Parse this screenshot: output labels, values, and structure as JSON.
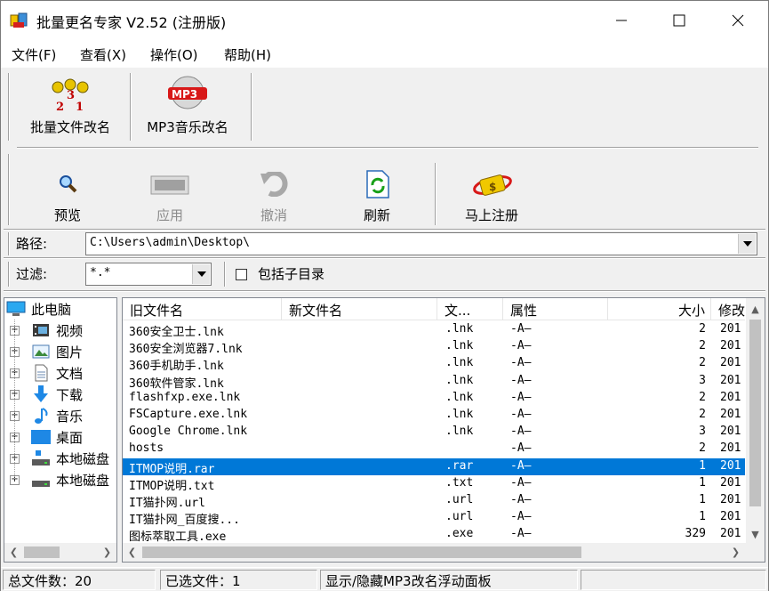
{
  "window": {
    "title": "批量更名专家 V2.52 (注册版)",
    "controls": {
      "minimize": "—",
      "maximize": "☐",
      "close": "✕"
    }
  },
  "menu": [
    "文件(F)",
    "查看(X)",
    "操作(O)",
    "帮助(H)"
  ],
  "toolbar_top": {
    "batch_rename": "批量文件改名",
    "mp3_rename": "MP3音乐改名"
  },
  "toolbar_actions": {
    "preview": "预览",
    "apply": "应用",
    "undo": "撤消",
    "refresh": "刷新",
    "register": "马上注册"
  },
  "path": {
    "label": "路径:",
    "value": "C:\\Users\\admin\\Desktop\\"
  },
  "filter": {
    "label": "过滤:",
    "value": "*.*",
    "include_subdirs": "包括子目录",
    "include_subdirs_checked": false
  },
  "tree": {
    "items": [
      {
        "label": "此电脑",
        "icon": "computer-icon"
      },
      {
        "label": "视频",
        "icon": "video-folder-icon"
      },
      {
        "label": "图片",
        "icon": "pictures-folder-icon"
      },
      {
        "label": "文档",
        "icon": "documents-folder-icon"
      },
      {
        "label": "下载",
        "icon": "downloads-folder-icon"
      },
      {
        "label": "音乐",
        "icon": "music-folder-icon"
      },
      {
        "label": "桌面",
        "icon": "desktop-folder-icon"
      },
      {
        "label": "本地磁盘",
        "icon": "drive-icon"
      },
      {
        "label": "本地磁盘",
        "icon": "drive-icon"
      }
    ]
  },
  "list": {
    "headers": [
      "旧文件名",
      "新文件名",
      "文...",
      "属性",
      "大小",
      "修改"
    ],
    "rows": [
      {
        "old": "360安全卫士.lnk",
        "new": "",
        "ext": ".lnk",
        "attr": "-A—",
        "size": "2",
        "mod": "201"
      },
      {
        "old": "360安全浏览器7.lnk",
        "new": "",
        "ext": ".lnk",
        "attr": "-A—",
        "size": "2",
        "mod": "201"
      },
      {
        "old": "360手机助手.lnk",
        "new": "",
        "ext": ".lnk",
        "attr": "-A—",
        "size": "2",
        "mod": "201"
      },
      {
        "old": "360软件管家.lnk",
        "new": "",
        "ext": ".lnk",
        "attr": "-A—",
        "size": "3",
        "mod": "201"
      },
      {
        "old": "flashfxp.exe.lnk",
        "new": "",
        "ext": ".lnk",
        "attr": "-A—",
        "size": "2",
        "mod": "201"
      },
      {
        "old": "FSCapture.exe.lnk",
        "new": "",
        "ext": ".lnk",
        "attr": "-A—",
        "size": "2",
        "mod": "201"
      },
      {
        "old": "Google Chrome.lnk",
        "new": "",
        "ext": ".lnk",
        "attr": "-A—",
        "size": "3",
        "mod": "201"
      },
      {
        "old": "hosts",
        "new": "",
        "ext": "",
        "attr": "-A—",
        "size": "2",
        "mod": "201"
      },
      {
        "old": "ITMOP说明.rar",
        "new": "",
        "ext": ".rar",
        "attr": "-A—",
        "size": "1",
        "mod": "201",
        "selected": true
      },
      {
        "old": "ITMOP说明.txt",
        "new": "",
        "ext": ".txt",
        "attr": "-A—",
        "size": "1",
        "mod": "201"
      },
      {
        "old": "IT猫扑网.url",
        "new": "",
        "ext": ".url",
        "attr": "-A—",
        "size": "1",
        "mod": "201"
      },
      {
        "old": "IT猫扑网_百度搜...",
        "new": "",
        "ext": ".url",
        "attr": "-A—",
        "size": "1",
        "mod": "201"
      },
      {
        "old": "图标萃取工具.exe",
        "new": "",
        "ext": ".exe",
        "attr": "-A—",
        "size": "329",
        "mod": "201"
      }
    ]
  },
  "status": {
    "total": "总文件数：20",
    "selected": "已选文件：1",
    "hint": "显示/隐藏MP3改名浮动面板"
  }
}
